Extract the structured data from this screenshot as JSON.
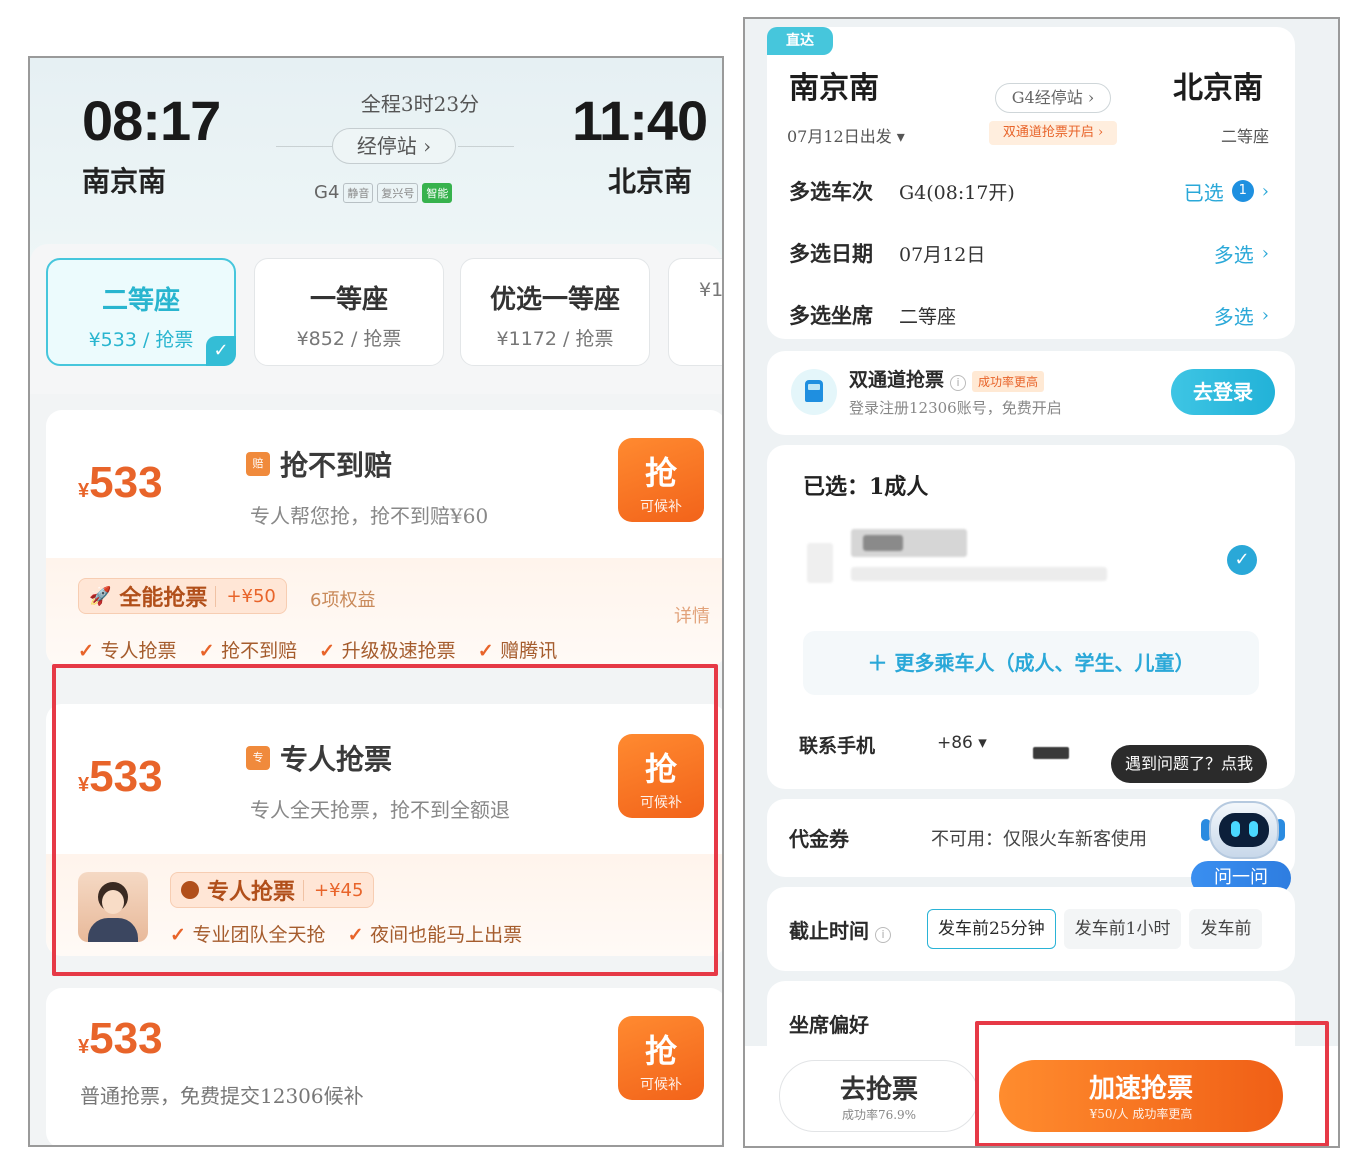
{
  "left": {
    "depart_time": "08:17",
    "arrive_time": "11:40",
    "depart_station": "南京南",
    "arrive_station": "北京南",
    "duration": "全程3时23分",
    "via_label": "经停站 ›",
    "train_no": "G4",
    "train_tags": [
      "静音",
      "复兴号",
      "智能"
    ],
    "seats": [
      {
        "name": "二等座",
        "price": "¥533 / 抢票"
      },
      {
        "name": "一等座",
        "price": "¥852 / 抢票"
      },
      {
        "name": "优选一等座",
        "price": "¥1172 / 抢票"
      },
      {
        "name": "",
        "price": "¥1"
      }
    ],
    "options": [
      {
        "price": "533",
        "yen": "¥",
        "title": "抢不到赔",
        "icon_text": "赔",
        "subtitle": "专人帮您抢，抢不到赔¥60",
        "btn_main": "抢",
        "btn_sub": "可候补",
        "upsell_name": "全能抢票",
        "upsell_add": "+¥50",
        "upsell_benefits": "6项权益",
        "detail_link": "详情",
        "checks": [
          "专人抢票",
          "抢不到赔",
          "升级极速抢票",
          "赠腾讯"
        ]
      },
      {
        "price": "533",
        "yen": "¥",
        "title": "专人抢票",
        "icon_text": "专",
        "subtitle": "专人全天抢票，抢不到全额退",
        "btn_main": "抢",
        "btn_sub": "可候补",
        "upsell_name": "专人抢票",
        "upsell_add": "+¥45",
        "checks": [
          "专业团队全天抢",
          "夜间也能马上出票"
        ]
      },
      {
        "price": "533",
        "yen": "¥",
        "subtitle": "普通抢票，免费提交12306候补",
        "btn_main": "抢",
        "btn_sub": "可候补"
      }
    ]
  },
  "right": {
    "direct_tag": "直达",
    "depart_station": "南京南",
    "arrive_station": "北京南",
    "depart_date": "07月12日出发 ▾",
    "seat_class": "二等座",
    "via_label": "G4经停站 ›",
    "dual_label": "双通道抢票开启 ›",
    "rows": [
      {
        "label": "多选车次",
        "value": "G4(08:17开)",
        "action": "已选",
        "badge": "1"
      },
      {
        "label": "多选日期",
        "value": "07月12日",
        "action": "多选"
      },
      {
        "label": "多选坐席",
        "value": "二等座",
        "action": "多选"
      }
    ],
    "dual": {
      "title": "双通道抢票",
      "pill": "成功率更高",
      "info": "i",
      "desc": "登录注册12306账号，免费开启",
      "button": "去登录"
    },
    "passenger": {
      "selected": "已选：1成人",
      "add_more": "＋ 更多乘车人（成人、学生、儿童）"
    },
    "contact": {
      "label": "联系手机",
      "code": "+86 ▾"
    },
    "tooltip": "遇到问题了？点我",
    "ask_btn": "问一问",
    "coupon": {
      "label": "代金券",
      "value": "不可用：仅限火车新客使用"
    },
    "deadline": {
      "label": "截止时间",
      "info": "i",
      "chips": [
        "发车前25分钟",
        "发车前1小时",
        "发车前"
      ]
    },
    "seat_pref": "坐席偏好",
    "btn_secondary": {
      "title": "去抢票",
      "sub": "成功率76.9%"
    },
    "btn_primary": {
      "title": "加速抢票",
      "sub": "¥50/人 成功率更高"
    }
  },
  "colors": {
    "accent_orange": "#f2631a",
    "accent_teal": "#2aa8d8",
    "highlight_red": "#e63946"
  }
}
